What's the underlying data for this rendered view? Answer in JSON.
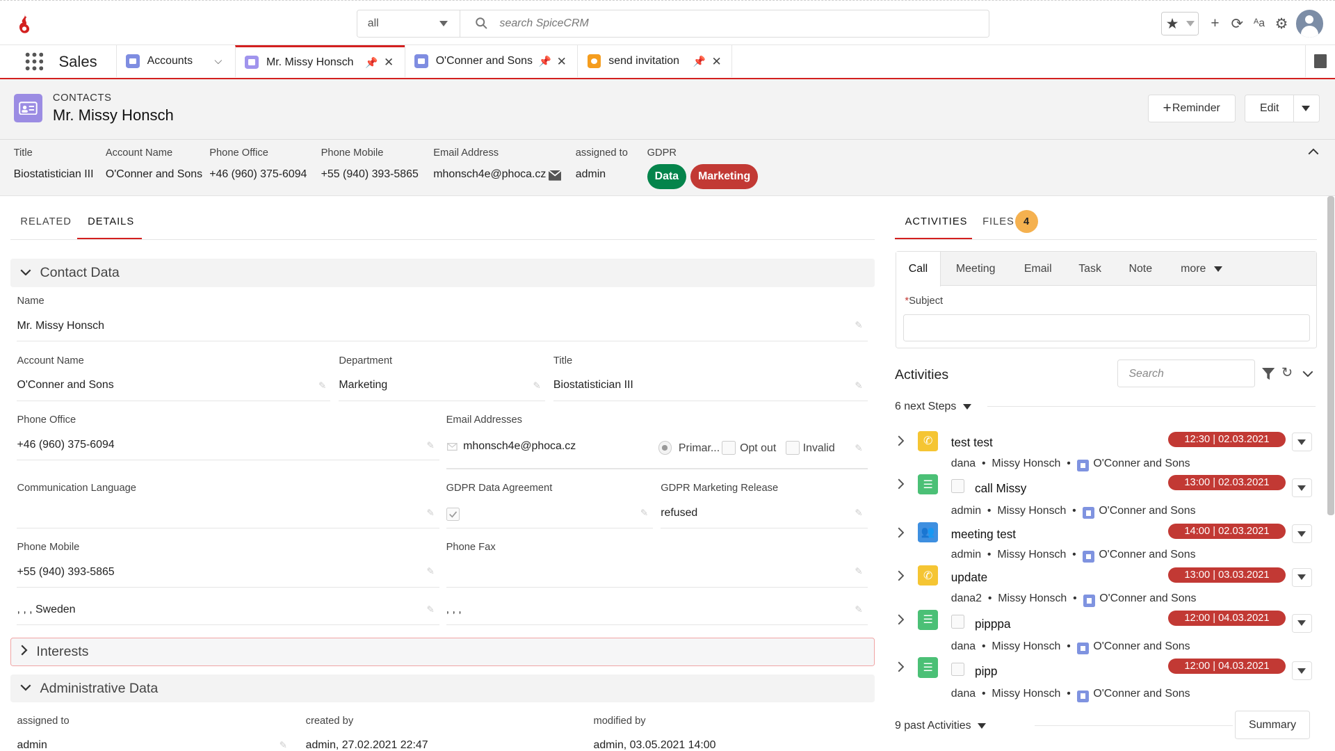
{
  "topbar": {
    "search_scope": "all",
    "search_placeholder": "search SpiceCRM",
    "icons": [
      "spicecrm-logo",
      "star-icon",
      "plus-icon",
      "refresh-icon",
      "language-icon",
      "gear-icon",
      "user-avatar-icon"
    ]
  },
  "tabbar": {
    "app_name": "Sales",
    "tabs": [
      {
        "label": "Accounts",
        "icon_color": "#7f8de1"
      },
      {
        "label": "Mr. Missy Honsch",
        "icon_color": "#a094ed"
      },
      {
        "label": "O'Conner and Sons",
        "icon_color": "#7f8de1"
      },
      {
        "label": "send invitation",
        "icon_color": "#f59d1e"
      }
    ]
  },
  "record": {
    "type": "CONTACTS",
    "name": "Mr. Missy Honsch",
    "reminder_label": "Reminder",
    "edit_label": "Edit"
  },
  "highlights": {
    "title_label": "Title",
    "title": "Biostatistician III",
    "account_label": "Account Name",
    "account": "O'Conner and Sons",
    "phone_office_label": "Phone Office",
    "phone_office": "+46 (960) 375-6094",
    "phone_mobile_label": "Phone Mobile",
    "phone_mobile": "+55 (940) 393-5865",
    "email_label": "Email Address",
    "email": "mhonsch4e@phoca.cz",
    "assigned_label": "assigned to",
    "assigned": "admin",
    "gdpr_label": "GDPR",
    "gdpr_data": "Data",
    "gdpr_marketing": "Marketing",
    "gdpr_data_color": "#04844b",
    "gdpr_marketing_color": "#c23934"
  },
  "left_tabs": {
    "related": "RELATED",
    "details": "DETAILS"
  },
  "contact_data": {
    "title": "Contact Data",
    "name_label": "Name",
    "name": "Mr. Missy Honsch",
    "account_label": "Account Name",
    "account": "O'Conner and Sons",
    "department_label": "Department",
    "department": "Marketing",
    "title_label": "Title",
    "title_value": "Biostatistician III",
    "phone_office_label": "Phone Office",
    "phone_office": "+46 (960) 375-6094",
    "email_label": "Email Addresses",
    "email": "mhonsch4e@phoca.cz",
    "email_primary": "Primar...",
    "email_optout": "Opt out",
    "email_invalid": "Invalid",
    "comm_lang_label": "Communication Language",
    "gdpr_agreement_label": "GDPR Data Agreement",
    "gdpr_marketing_label": "GDPR Marketing Release",
    "gdpr_marketing": "refused",
    "phone_mobile_label": "Phone Mobile",
    "phone_mobile": "+55 (940) 393-5865",
    "phone_fax_label": "Phone Fax",
    "address_primary": ", , , Sweden",
    "address_alt": ", , ,"
  },
  "interests": {
    "title": "Interests"
  },
  "admin_data": {
    "title": "Administrative Data",
    "assigned_label": "assigned to",
    "assigned": "admin",
    "created_label": "created by",
    "created": "admin, 27.02.2021 22:47",
    "modified_label": "modified by",
    "modified": "admin, 03.05.2021 14:00"
  },
  "right_tabs": {
    "activities": "ACTIVITIES",
    "files": "FILES",
    "files_count": "4"
  },
  "quick_create": {
    "tabs": [
      "Call",
      "Meeting",
      "Email",
      "Task",
      "Note",
      "more"
    ],
    "subject_label": "Subject"
  },
  "activities": {
    "title": "Activities",
    "search_placeholder": "Search",
    "next_steps": "6 next Steps",
    "past": "9 past Activities",
    "summary_label": "Summary",
    "items": [
      {
        "type": "call",
        "color": "#f5c533",
        "title": "test test",
        "date": "12:30 | 02.03.2021",
        "user": "dana",
        "contact": "Missy Honsch",
        "account": "O'Conner and Sons",
        "checkbox": false
      },
      {
        "type": "task",
        "color": "#4bc076",
        "title": "call Missy",
        "date": "13:00 | 02.03.2021",
        "user": "admin",
        "contact": "Missy Honsch",
        "account": "O'Conner and Sons",
        "checkbox": true
      },
      {
        "type": "meeting",
        "color": "#3e8fe0",
        "title": "meeting test",
        "date": "14:00 | 02.03.2021",
        "user": "admin",
        "contact": "Missy Honsch",
        "account": "O'Conner and Sons",
        "checkbox": false
      },
      {
        "type": "call",
        "color": "#f5c533",
        "title": "update",
        "date": "13:00 | 03.03.2021",
        "user": "dana2",
        "contact": "Missy Honsch",
        "account": "O'Conner and Sons",
        "checkbox": false
      },
      {
        "type": "task",
        "color": "#4bc076",
        "title": "pipppa",
        "date": "12:00 | 04.03.2021",
        "user": "dana",
        "contact": "Missy Honsch",
        "account": "O'Conner and Sons",
        "checkbox": true
      },
      {
        "type": "task",
        "color": "#4bc076",
        "title": "pipp",
        "date": "12:00 | 04.03.2021",
        "user": "dana",
        "contact": "Missy Honsch",
        "account": "O'Conner and Sons",
        "checkbox": true
      }
    ]
  }
}
